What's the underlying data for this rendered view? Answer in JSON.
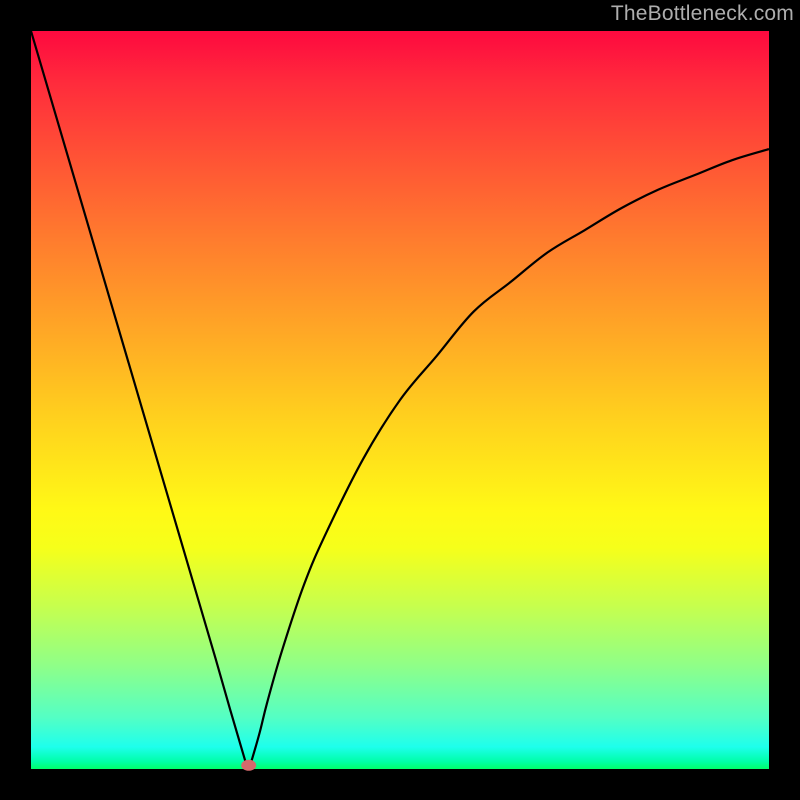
{
  "watermark": "TheBottleneck.com",
  "chart_data": {
    "type": "line",
    "title": "",
    "xlabel": "",
    "ylabel": "",
    "xlim": [
      0,
      100
    ],
    "ylim": [
      0,
      100
    ],
    "grid": false,
    "series": [
      {
        "name": "bottleneck-curve-left",
        "x": [
          0,
          5,
          10,
          15,
          20,
          25,
          27,
          29,
          29.5
        ],
        "values": [
          100,
          83,
          66,
          49,
          32,
          15,
          8,
          1.2,
          0
        ]
      },
      {
        "name": "bottleneck-curve-right",
        "x": [
          29.5,
          30,
          31,
          32,
          34,
          37,
          40,
          45,
          50,
          55,
          60,
          65,
          70,
          75,
          80,
          85,
          90,
          95,
          100
        ],
        "values": [
          0,
          1.5,
          5,
          9,
          16,
          25,
          32,
          42,
          50,
          56,
          62,
          66,
          70,
          73,
          76,
          78.5,
          80.5,
          82.5,
          84
        ]
      }
    ],
    "marker": {
      "x": 29.5,
      "y": 0.5
    }
  }
}
